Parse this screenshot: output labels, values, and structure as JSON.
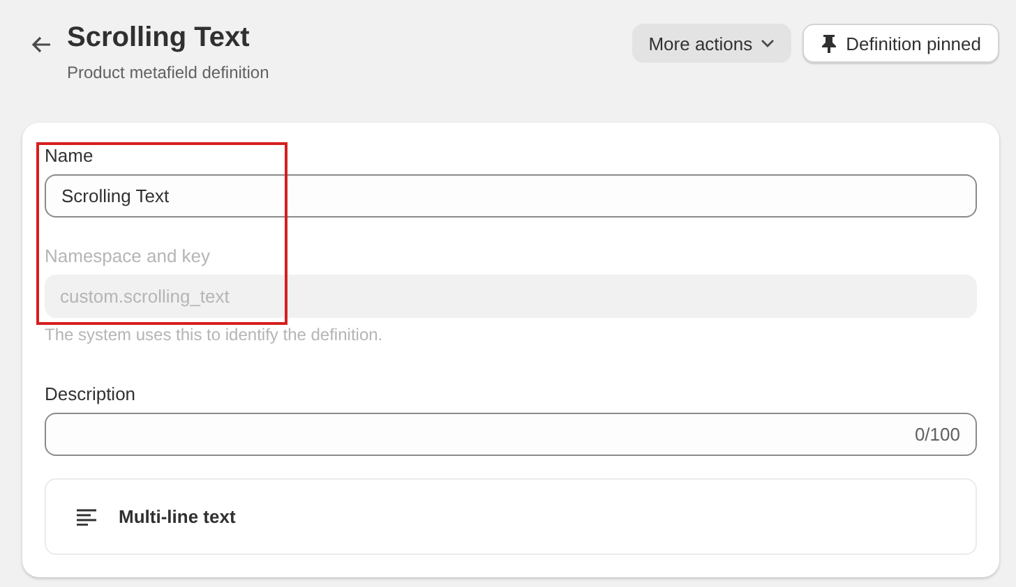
{
  "header": {
    "title": "Scrolling Text",
    "subtitle": "Product metafield definition",
    "actions": [
      {
        "label": "More actions",
        "kind": "menu"
      },
      {
        "label": "Definition pinned",
        "kind": "pin"
      }
    ]
  },
  "fields": [
    {
      "label": "Name",
      "value": "Scrolling Text",
      "disabled": false,
      "highlighted": true
    },
    {
      "label": "Namespace and key",
      "value": "custom.scrolling_text",
      "disabled": true,
      "highlighted": true,
      "help": "The system uses this to identify the definition."
    },
    {
      "label": "Description",
      "counter": "0/100",
      "disabled": false
    }
  ],
  "type": {
    "label": "Multi-line text"
  }
}
